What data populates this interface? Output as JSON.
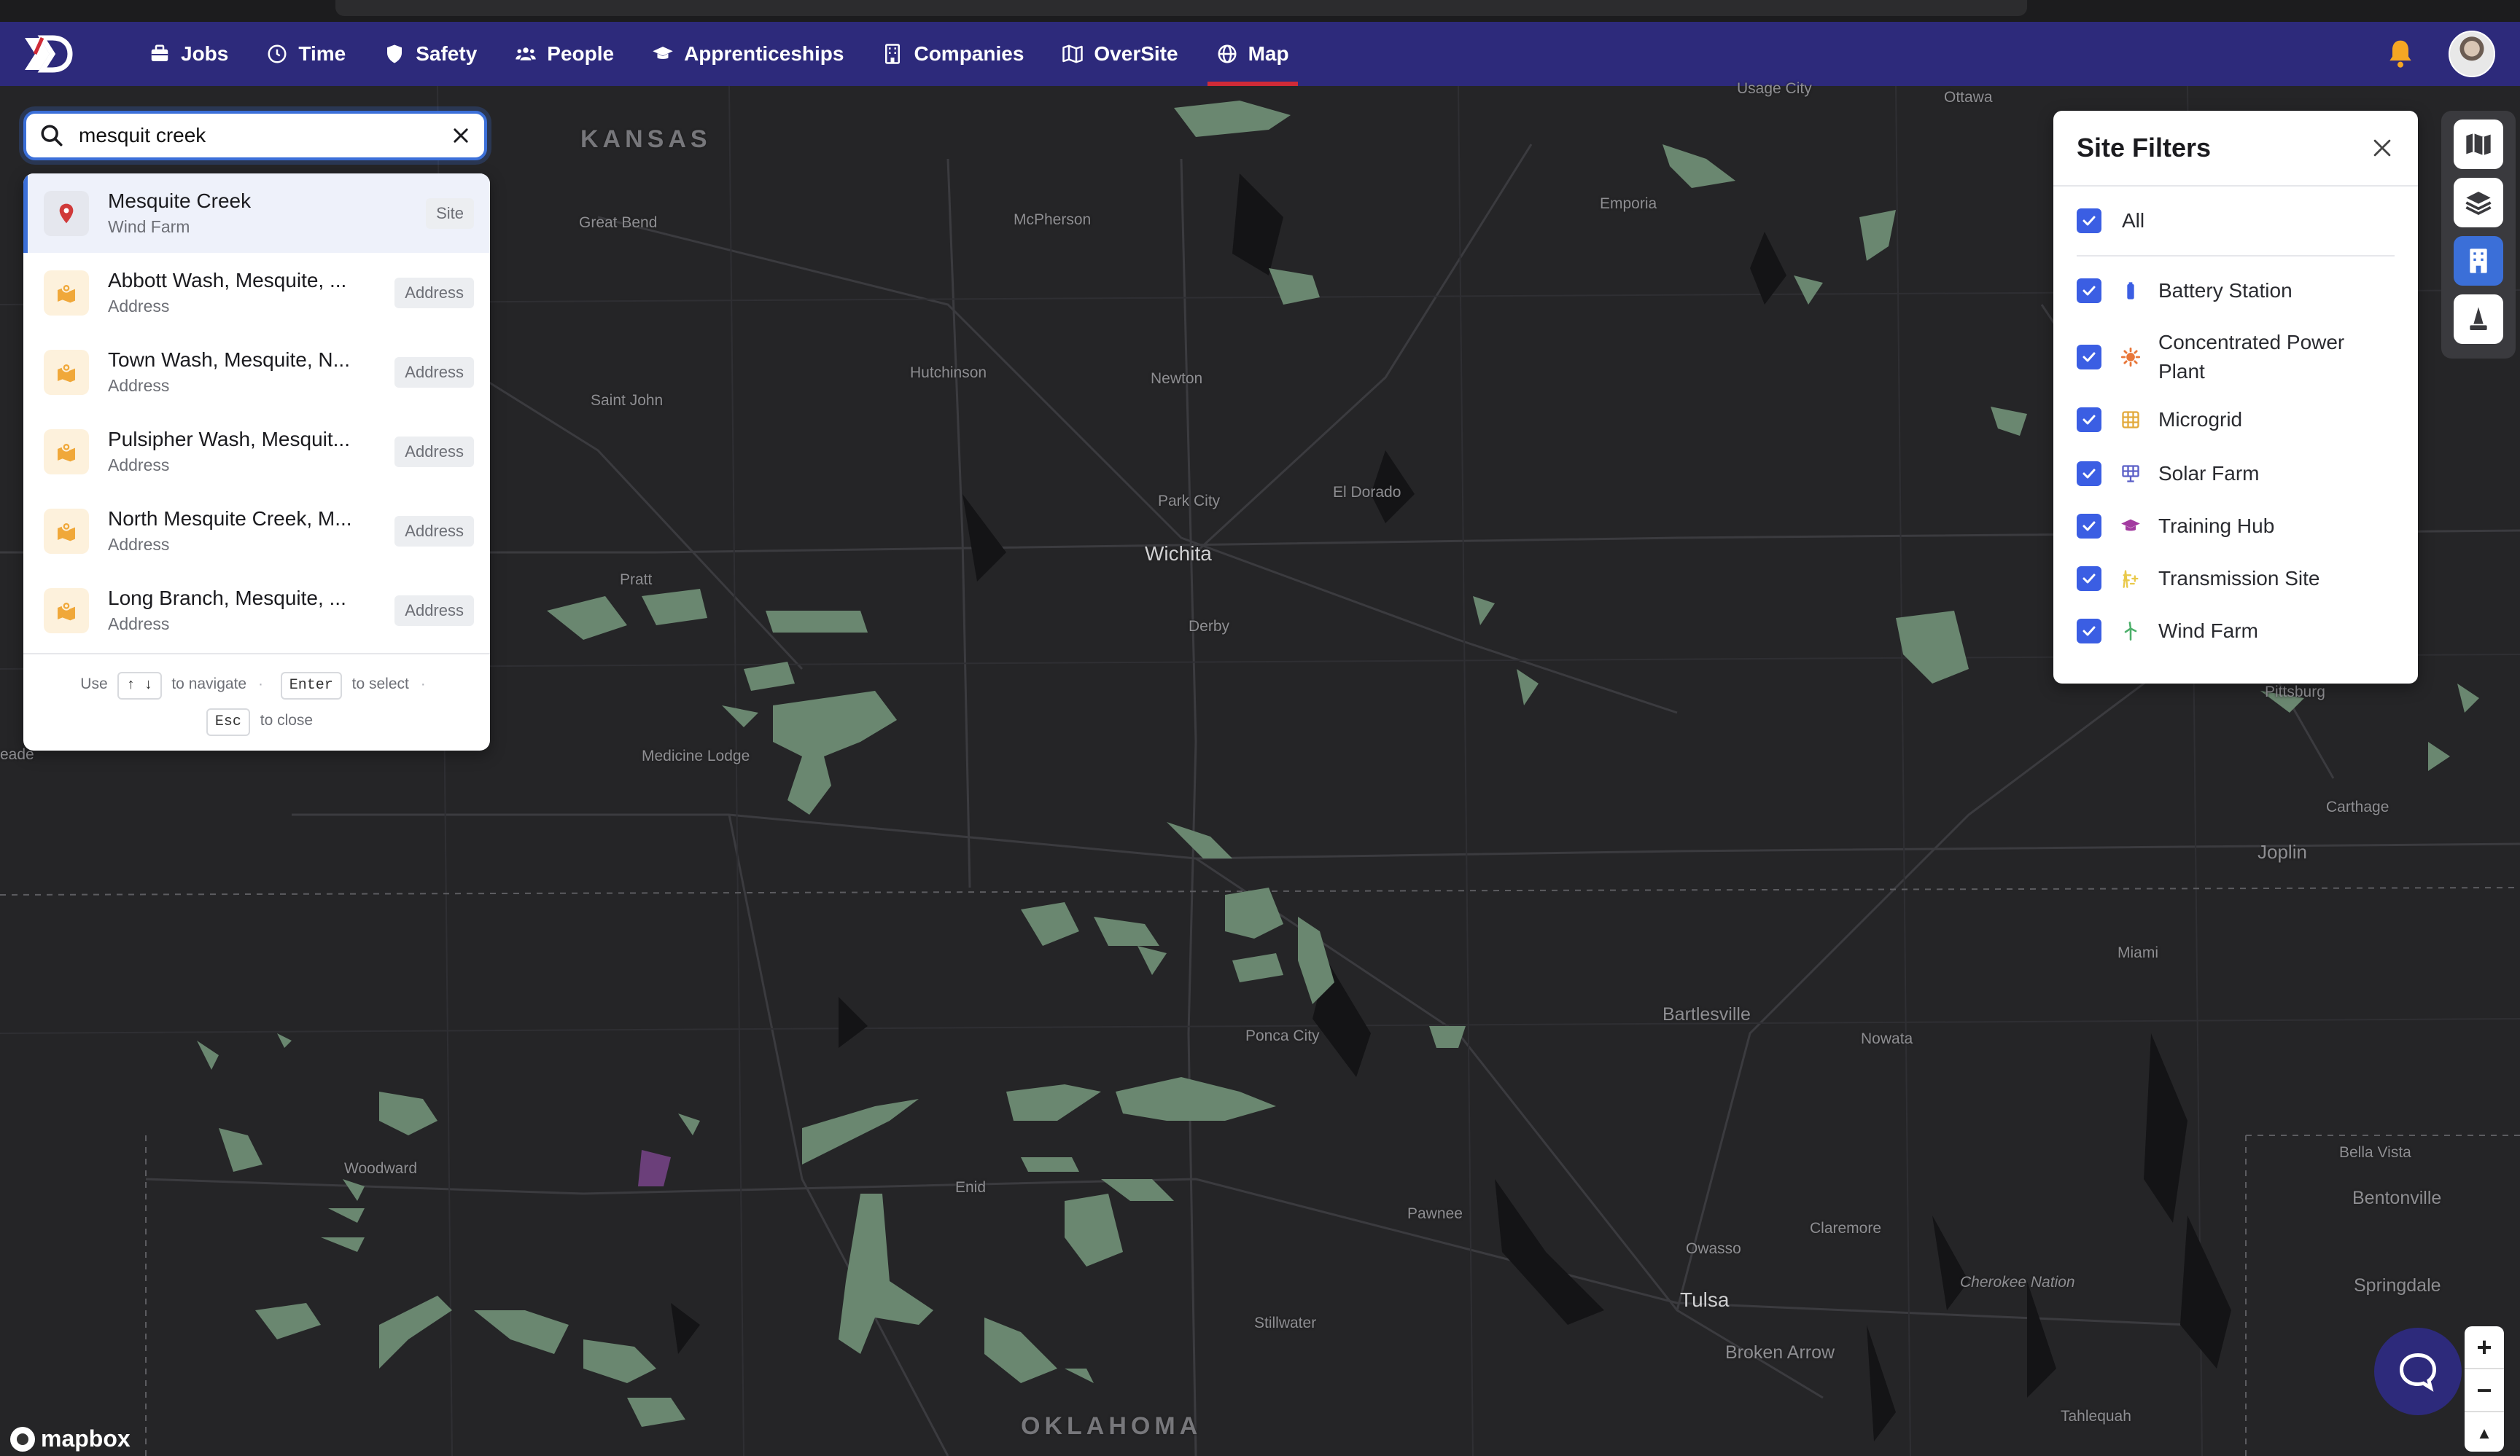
{
  "nav": {
    "items": [
      {
        "label": "Jobs",
        "icon": "briefcase-icon"
      },
      {
        "label": "Time",
        "icon": "clock-icon"
      },
      {
        "label": "Safety",
        "icon": "shield-icon"
      },
      {
        "label": "People",
        "icon": "people-icon"
      },
      {
        "label": "Apprenticeships",
        "icon": "graduation-cap-icon"
      },
      {
        "label": "Companies",
        "icon": "building-icon"
      },
      {
        "label": "OverSite",
        "icon": "map-icon"
      },
      {
        "label": "Map",
        "icon": "globe-icon",
        "active": true
      }
    ],
    "accent": "#d02b37",
    "bar_color": "#2d2a7b"
  },
  "search": {
    "value": "mesquit creek",
    "results": [
      {
        "title": "Mesquite Creek",
        "subtitle": "Wind Farm",
        "tag": "Site",
        "type": "site"
      },
      {
        "title": "Abbott Wash, Mesquite, ...",
        "subtitle": "Address",
        "tag": "Address",
        "type": "address"
      },
      {
        "title": "Town Wash, Mesquite, N...",
        "subtitle": "Address",
        "tag": "Address",
        "type": "address"
      },
      {
        "title": "Pulsipher Wash, Mesquit...",
        "subtitle": "Address",
        "tag": "Address",
        "type": "address"
      },
      {
        "title": "North Mesquite Creek, M...",
        "subtitle": "Address",
        "tag": "Address",
        "type": "address"
      },
      {
        "title": "Long Branch, Mesquite, ...",
        "subtitle": "Address",
        "tag": "Address",
        "type": "address"
      }
    ],
    "footer": {
      "use": "Use",
      "nav_keys": "↑ ↓",
      "to_navigate": "to navigate",
      "enter_key": "Enter",
      "to_select": "to select",
      "esc_key": "Esc",
      "to_close": "to close"
    }
  },
  "filters": {
    "title": "Site Filters",
    "all_label": "All",
    "items": [
      {
        "label": "Battery Station",
        "icon": "battery-icon",
        "color": "#3b5ee3"
      },
      {
        "label": "Concentrated Power Plant",
        "icon": "sun-burst-icon",
        "color": "#e8773a"
      },
      {
        "label": "Microgrid",
        "icon": "grid-icon",
        "color": "#e2a93b"
      },
      {
        "label": "Solar Farm",
        "icon": "solar-panel-icon",
        "color": "#5b5fc7"
      },
      {
        "label": "Training Hub",
        "icon": "graduation-cap-icon",
        "color": "#a33ba0"
      },
      {
        "label": "Transmission Site",
        "icon": "transmission-icon",
        "color": "#e9c94a"
      },
      {
        "label": "Wind Farm",
        "icon": "wind-turbine-icon",
        "color": "#4caf6a"
      }
    ]
  },
  "map": {
    "labels": [
      {
        "text": "KANSAS",
        "kind": "state"
      },
      {
        "text": "OKLAHOMA",
        "kind": "state"
      },
      {
        "text": "Wichita",
        "kind": "city"
      },
      {
        "text": "Tulsa",
        "kind": "city"
      },
      {
        "text": "Great Bend",
        "kind": "town"
      },
      {
        "text": "McPherson",
        "kind": "town"
      },
      {
        "text": "Emporia",
        "kind": "town"
      },
      {
        "text": "Hutchinson",
        "kind": "town"
      },
      {
        "text": "Newton",
        "kind": "town"
      },
      {
        "text": "Saint John",
        "kind": "town"
      },
      {
        "text": "Park City",
        "kind": "town"
      },
      {
        "text": "El Dorado",
        "kind": "town"
      },
      {
        "text": "Pratt",
        "kind": "town"
      },
      {
        "text": "Derby",
        "kind": "town"
      },
      {
        "text": "Medicine Lodge",
        "kind": "town"
      },
      {
        "text": "Pittsburg",
        "kind": "town"
      },
      {
        "text": "Carthage",
        "kind": "town"
      },
      {
        "text": "Joplin",
        "kind": "town"
      },
      {
        "text": "Miami",
        "kind": "town"
      },
      {
        "text": "Bartlesville",
        "kind": "town"
      },
      {
        "text": "Nowata",
        "kind": "town"
      },
      {
        "text": "Ponca City",
        "kind": "town"
      },
      {
        "text": "Woodward",
        "kind": "town"
      },
      {
        "text": "Enid",
        "kind": "town"
      },
      {
        "text": "Pawnee",
        "kind": "town"
      },
      {
        "text": "Claremore",
        "kind": "town"
      },
      {
        "text": "Owasso",
        "kind": "town"
      },
      {
        "text": "Stillwater",
        "kind": "town"
      },
      {
        "text": "Broken Arrow",
        "kind": "town"
      },
      {
        "text": "Cherokee Nation",
        "kind": "town"
      },
      {
        "text": "Bella Vista",
        "kind": "town"
      },
      {
        "text": "Bentonville",
        "kind": "town"
      },
      {
        "text": "Springdale",
        "kind": "town"
      },
      {
        "text": "Tahlequah",
        "kind": "town"
      },
      {
        "text": "Ottawa",
        "kind": "town"
      },
      {
        "text": "Usage City",
        "kind": "town"
      },
      {
        "text": "eade",
        "kind": "town"
      }
    ],
    "region_color": "#6a8770",
    "highlight_color": "#6b3f7a"
  },
  "zoom": {
    "in": "+",
    "out": "−",
    "north": "▲"
  },
  "attribution": {
    "brand": "mapbox"
  }
}
